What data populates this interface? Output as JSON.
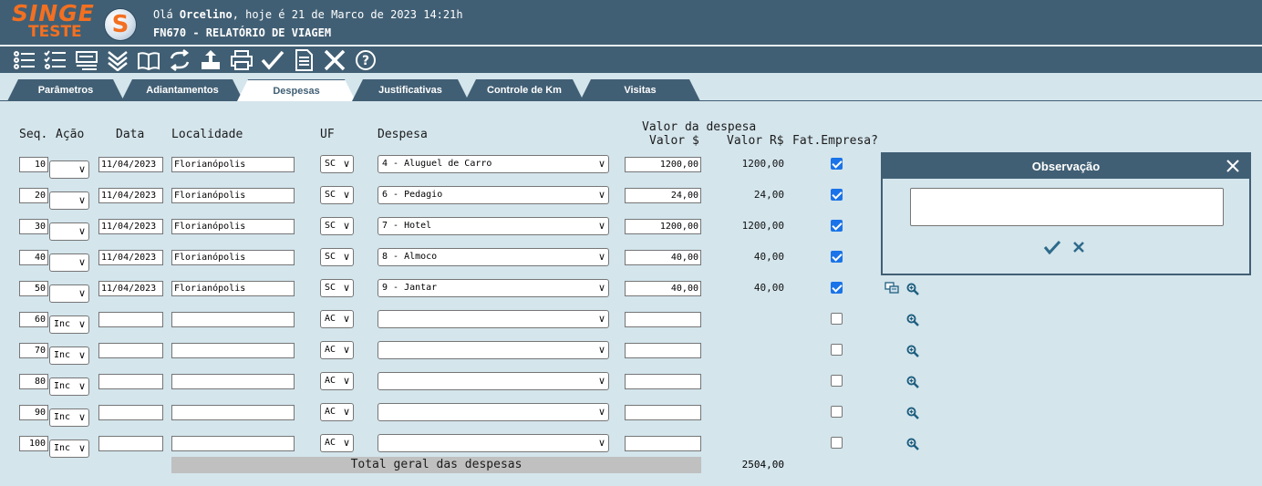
{
  "brand": {
    "name": "SINGE",
    "env": "TESTE",
    "symbol": "S",
    "accent": "#f37021",
    "header_bg": "#415f74"
  },
  "header": {
    "greeting_prefix": "Olá",
    "user": "Orcelino",
    "greeting_suffix": ", hoje é 21 de Marco de 2023 14:21h",
    "screen_title": "FN670 - RELATÓRIO DE VIAGEM"
  },
  "toolbar": {
    "icons": [
      "list-icon",
      "checklist-icon",
      "card-icon",
      "double-chevron-down-icon",
      "book-icon",
      "refresh-icon",
      "upload-icon",
      "print-icon",
      "check-icon",
      "document-icon",
      "close-icon",
      "help-icon"
    ]
  },
  "tabs": [
    {
      "label": "Parâmetros"
    },
    {
      "label": "Adiantamentos"
    },
    {
      "label": "Despesas",
      "active": true
    },
    {
      "label": "Justificativas"
    },
    {
      "label": "Controle de Km"
    },
    {
      "label": "Visitas"
    }
  ],
  "columns": {
    "seq": "Seq.",
    "acao": "Ação",
    "data": "Data",
    "localidade": "Localidade",
    "uf": "UF",
    "despesa": "Despesa",
    "valor_group": "Valor da despesa",
    "valor": "Valor $",
    "valor_rs": "Valor R$",
    "fat_empresa": "Fat.Empresa?"
  },
  "rows": [
    {
      "seq": "10",
      "acao": "",
      "data": "11/04/2023",
      "localidade": "Florianópolis",
      "uf": "SC",
      "despesa": "4 - Aluguel de Carro",
      "valor": "1200,00",
      "valor_rs": "1200,00",
      "fat": true
    },
    {
      "seq": "20",
      "acao": "",
      "data": "11/04/2023",
      "localidade": "Florianópolis",
      "uf": "SC",
      "despesa": "6 - Pedagio",
      "valor": "24,00",
      "valor_rs": "24,00",
      "fat": true
    },
    {
      "seq": "30",
      "acao": "",
      "data": "11/04/2023",
      "localidade": "Florianópolis",
      "uf": "SC",
      "despesa": "7 - Hotel",
      "valor": "1200,00",
      "valor_rs": "1200,00",
      "fat": true
    },
    {
      "seq": "40",
      "acao": "",
      "data": "11/04/2023",
      "localidade": "Florianópolis",
      "uf": "SC",
      "despesa": "8 - Almoco",
      "valor": "40,00",
      "valor_rs": "40,00",
      "fat": true
    },
    {
      "seq": "50",
      "acao": "",
      "data": "11/04/2023",
      "localidade": "Florianópolis",
      "uf": "SC",
      "despesa": "9 - Jantar",
      "valor": "40,00",
      "valor_rs": "40,00",
      "fat": true,
      "obs_icon": true,
      "zoom": true
    },
    {
      "seq": "60",
      "acao": "Inc",
      "data": "",
      "localidade": "",
      "uf": "AC",
      "despesa": "",
      "valor": "",
      "valor_rs": "",
      "fat": false,
      "zoom": true
    },
    {
      "seq": "70",
      "acao": "Inc",
      "data": "",
      "localidade": "",
      "uf": "AC",
      "despesa": "",
      "valor": "",
      "valor_rs": "",
      "fat": false,
      "zoom": true
    },
    {
      "seq": "80",
      "acao": "Inc",
      "data": "",
      "localidade": "",
      "uf": "AC",
      "despesa": "",
      "valor": "",
      "valor_rs": "",
      "fat": false,
      "zoom": true
    },
    {
      "seq": "90",
      "acao": "Inc",
      "data": "",
      "localidade": "",
      "uf": "AC",
      "despesa": "",
      "valor": "",
      "valor_rs": "",
      "fat": false,
      "zoom": true
    },
    {
      "seq": "100",
      "acao": "Inc",
      "data": "",
      "localidade": "",
      "uf": "AC",
      "despesa": "",
      "valor": "",
      "valor_rs": "",
      "fat": false,
      "zoom": true
    }
  ],
  "total": {
    "label": "Total geral das despesas",
    "value": "2504,00"
  },
  "observacao": {
    "title": "Observação",
    "text": ""
  }
}
